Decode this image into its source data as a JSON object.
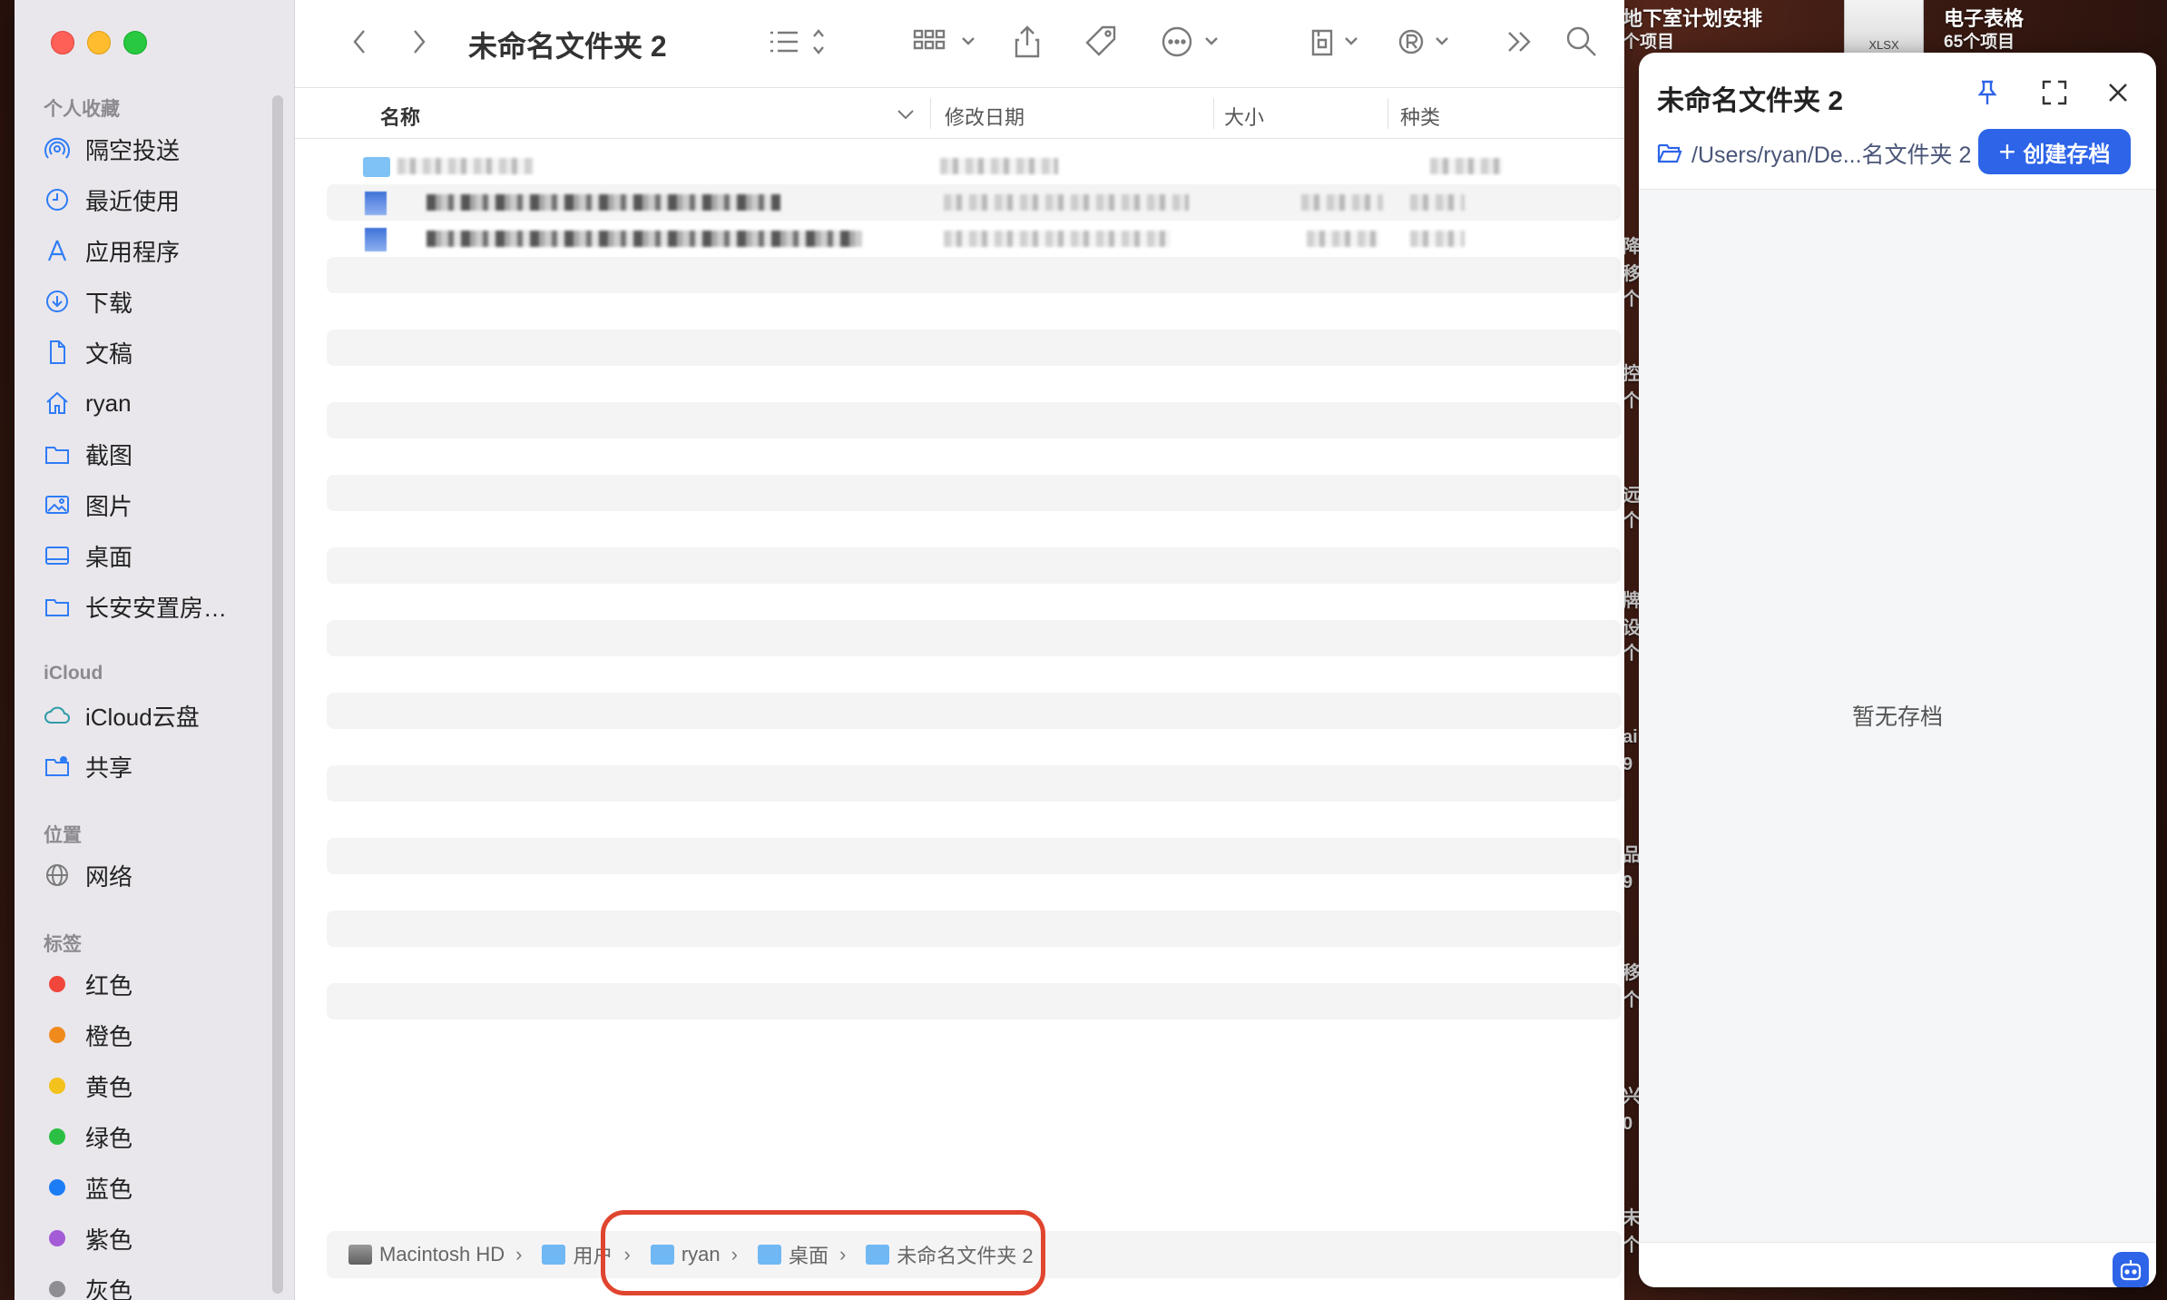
{
  "desktop": {
    "item1": {
      "title": "地下室计划安排",
      "sub": "个项目"
    },
    "item2": {
      "title": "电子表格",
      "sub": "65个项目"
    },
    "thumb_label": "XLSX",
    "fragments": [
      "降",
      "移",
      "个",
      "控",
      "个",
      "远",
      "个",
      "牌",
      "设",
      "个",
      "ai",
      "9",
      "品",
      "9",
      "移",
      "个",
      "兴",
      "0",
      "未",
      "个"
    ]
  },
  "window": {
    "title": "未命名文件夹 2"
  },
  "sidebar": {
    "favorites_heading": "个人收藏",
    "favorites": [
      {
        "label": "隔空投送",
        "icon": "airdrop-icon"
      },
      {
        "label": "最近使用",
        "icon": "clock-icon"
      },
      {
        "label": "应用程序",
        "icon": "applications-icon"
      },
      {
        "label": "下载",
        "icon": "download-icon"
      },
      {
        "label": "文稿",
        "icon": "document-icon"
      },
      {
        "label": "ryan",
        "icon": "home-icon"
      },
      {
        "label": "截图",
        "icon": "folder-icon"
      },
      {
        "label": "图片",
        "icon": "photo-icon"
      },
      {
        "label": "桌面",
        "icon": "desktop-icon"
      },
      {
        "label": "长安安置房…",
        "icon": "folder-icon"
      }
    ],
    "icloud_heading": "iCloud",
    "icloud": [
      {
        "label": "iCloud云盘",
        "icon": "cloud-icon"
      },
      {
        "label": "共享",
        "icon": "shared-folder-icon"
      }
    ],
    "locations_heading": "位置",
    "locations": [
      {
        "label": "网络",
        "icon": "globe-icon"
      }
    ],
    "tags_heading": "标签",
    "tags": [
      {
        "label": "红色",
        "color": "#f0463c"
      },
      {
        "label": "橙色",
        "color": "#f08a1d"
      },
      {
        "label": "黄色",
        "color": "#f4c21c"
      },
      {
        "label": "绿色",
        "color": "#2bc044"
      },
      {
        "label": "蓝色",
        "color": "#1b7cf5"
      },
      {
        "label": "紫色",
        "color": "#a45bd6"
      },
      {
        "label": "灰色",
        "color": "#8d8d92"
      }
    ]
  },
  "columns": {
    "name": "名称",
    "modified": "修改日期",
    "size": "大小",
    "kind": "种类"
  },
  "pathbar": {
    "crumbs": [
      "Macintosh HD",
      "用户",
      "ryan",
      "桌面",
      "未命名文件夹 2"
    ]
  },
  "panel": {
    "title": "未命名文件夹 2",
    "path": "/Users/ryan/De...名文件夹 2",
    "create_label": "创建存档",
    "create_icon": "plus-icon",
    "empty_text": "暂无存档"
  },
  "colors": {
    "accent": "#2d64e8",
    "highlight": "#e0452f"
  }
}
